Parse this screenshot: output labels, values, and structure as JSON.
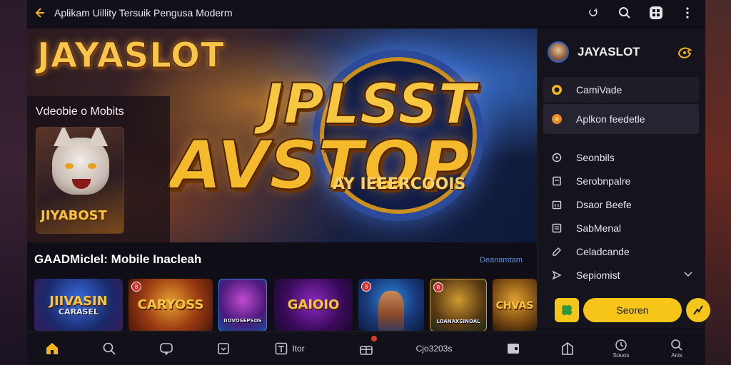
{
  "header": {
    "title": "Aplikam Uillity Tersuik Pengusa Moderm"
  },
  "hero": {
    "brand": "JAYASLOT",
    "headline_top": "JPLSST",
    "headline_bottom": "AVSTOP",
    "subline": "AY IEEERCOOIS",
    "caption": "Vdeobie o Mobits",
    "card_label": "JIYABOST"
  },
  "games": {
    "heading": "GAADMiclel: Mobile Inacleah",
    "see_all": "Deanamtam",
    "tiles": [
      {
        "label": "JIIVASIN",
        "sub": "CARASEL",
        "badge": ""
      },
      {
        "label": "CARYOSS",
        "sub": "",
        "badge": "8"
      },
      {
        "label": "",
        "sub": "IIOVOSEPSOS",
        "badge": ""
      },
      {
        "label": "GAIOIO",
        "sub": "",
        "badge": ""
      },
      {
        "label": "",
        "sub": "",
        "badge": "8"
      },
      {
        "label": "",
        "sub": "LOANAXSINOAL",
        "badge": "8"
      },
      {
        "label": "CHVAS",
        "sub": "",
        "badge": ""
      }
    ]
  },
  "panel": {
    "brand": "JAYASLOT",
    "highlight_items": [
      {
        "label": "CamiVade"
      },
      {
        "label": "Aplkon feedetle"
      }
    ],
    "menu_items": [
      {
        "label": "Seonbils"
      },
      {
        "label": "Serobnpalre"
      },
      {
        "label": "Dsaor Beefe"
      },
      {
        "label": "SabMenal"
      },
      {
        "label": "Celadcande"
      },
      {
        "label": "Sepiomist"
      }
    ],
    "primary_button": "Seoren"
  },
  "bottom_nav": {
    "items": [
      {
        "label": "",
        "tiny": ""
      },
      {
        "label": "",
        "tiny": ""
      },
      {
        "label": "",
        "tiny": ""
      },
      {
        "label": "",
        "tiny": ""
      },
      {
        "label": "Itor",
        "tiny": ""
      },
      {
        "label": "",
        "tiny": ""
      },
      {
        "label": "Cjo3203s",
        "tiny": ""
      },
      {
        "label": "",
        "tiny": ""
      },
      {
        "label": "",
        "tiny": ""
      },
      {
        "label": "",
        "tiny": "Souos"
      },
      {
        "label": "",
        "tiny": "Anis"
      }
    ]
  },
  "colors": {
    "accent": "#f2b51c",
    "link": "#5a8ee8",
    "background": "#0f0e16"
  }
}
